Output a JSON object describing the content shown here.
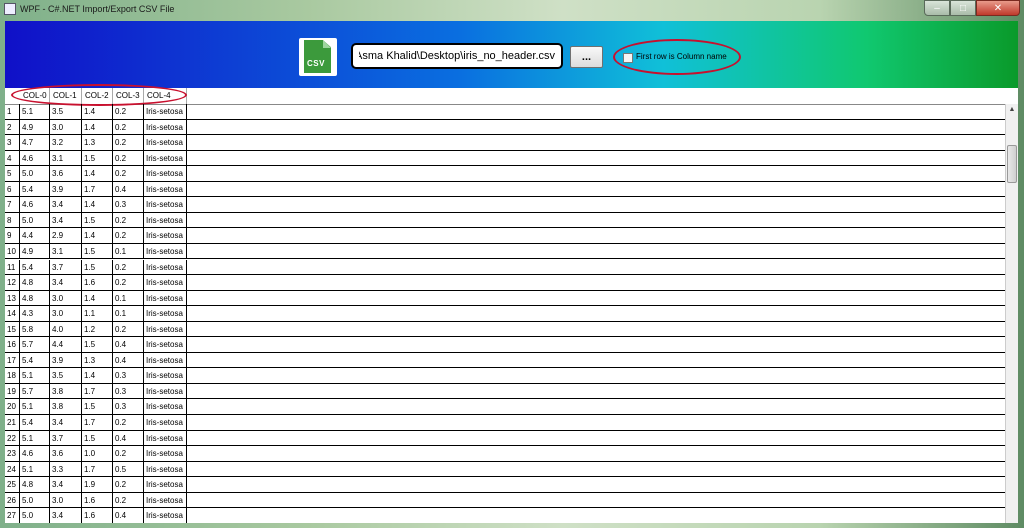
{
  "window": {
    "title": "WPF - C#.NET Import/Export CSV File"
  },
  "toolbar": {
    "csv_icon_label": "CSV",
    "file_path": "C:\\Users\\Asma Khalid\\Desktop\\iris_no_header.csv",
    "browse_label": "...",
    "checkbox_label": "First row is Column name",
    "checkbox_checked": false
  },
  "grid": {
    "columns": [
      "COL-0",
      "COL-1",
      "COL-2",
      "COL-3",
      "COL-4"
    ],
    "rows": [
      [
        "1",
        "5.1",
        "3.5",
        "1.4",
        "0.2",
        "Iris-setosa"
      ],
      [
        "2",
        "4.9",
        "3.0",
        "1.4",
        "0.2",
        "Iris-setosa"
      ],
      [
        "3",
        "4.7",
        "3.2",
        "1.3",
        "0.2",
        "Iris-setosa"
      ],
      [
        "4",
        "4.6",
        "3.1",
        "1.5",
        "0.2",
        "Iris-setosa"
      ],
      [
        "5",
        "5.0",
        "3.6",
        "1.4",
        "0.2",
        "Iris-setosa"
      ],
      [
        "6",
        "5.4",
        "3.9",
        "1.7",
        "0.4",
        "Iris-setosa"
      ],
      [
        "7",
        "4.6",
        "3.4",
        "1.4",
        "0.3",
        "Iris-setosa"
      ],
      [
        "8",
        "5.0",
        "3.4",
        "1.5",
        "0.2",
        "Iris-setosa"
      ],
      [
        "9",
        "4.4",
        "2.9",
        "1.4",
        "0.2",
        "Iris-setosa"
      ],
      [
        "10",
        "4.9",
        "3.1",
        "1.5",
        "0.1",
        "Iris-setosa"
      ],
      [
        "11",
        "5.4",
        "3.7",
        "1.5",
        "0.2",
        "Iris-setosa"
      ],
      [
        "12",
        "4.8",
        "3.4",
        "1.6",
        "0.2",
        "Iris-setosa"
      ],
      [
        "13",
        "4.8",
        "3.0",
        "1.4",
        "0.1",
        "Iris-setosa"
      ],
      [
        "14",
        "4.3",
        "3.0",
        "1.1",
        "0.1",
        "Iris-setosa"
      ],
      [
        "15",
        "5.8",
        "4.0",
        "1.2",
        "0.2",
        "Iris-setosa"
      ],
      [
        "16",
        "5.7",
        "4.4",
        "1.5",
        "0.4",
        "Iris-setosa"
      ],
      [
        "17",
        "5.4",
        "3.9",
        "1.3",
        "0.4",
        "Iris-setosa"
      ],
      [
        "18",
        "5.1",
        "3.5",
        "1.4",
        "0.3",
        "Iris-setosa"
      ],
      [
        "19",
        "5.7",
        "3.8",
        "1.7",
        "0.3",
        "Iris-setosa"
      ],
      [
        "20",
        "5.1",
        "3.8",
        "1.5",
        "0.3",
        "Iris-setosa"
      ],
      [
        "21",
        "5.4",
        "3.4",
        "1.7",
        "0.2",
        "Iris-setosa"
      ],
      [
        "22",
        "5.1",
        "3.7",
        "1.5",
        "0.4",
        "Iris-setosa"
      ],
      [
        "23",
        "4.6",
        "3.6",
        "1.0",
        "0.2",
        "Iris-setosa"
      ],
      [
        "24",
        "5.1",
        "3.3",
        "1.7",
        "0.5",
        "Iris-setosa"
      ],
      [
        "25",
        "4.8",
        "3.4",
        "1.9",
        "0.2",
        "Iris-setosa"
      ],
      [
        "26",
        "5.0",
        "3.0",
        "1.6",
        "0.2",
        "Iris-setosa"
      ],
      [
        "27",
        "5.0",
        "3.4",
        "1.6",
        "0.4",
        "Iris-setosa"
      ]
    ]
  },
  "colors": {
    "annotation_red": "#c8102e",
    "toolbar_gradient": [
      "#1010c8",
      "#0a6fe0",
      "#10c0d8",
      "#10c870",
      "#0a9a2a"
    ]
  }
}
